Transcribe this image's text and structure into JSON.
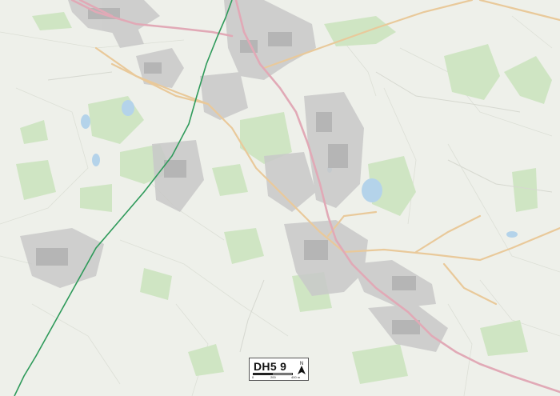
{
  "map": {
    "title": "DH5 9",
    "north_label": "N",
    "scale": {
      "ticks": [
        "0",
        "200",
        "400 m"
      ]
    },
    "colors": {
      "background": "#eef0ea",
      "woodland": "#cfe5c3",
      "water": "#b4d3ea",
      "urban": "#c9c9c9",
      "main_road": "#e1a9b6",
      "secondary_road": "#e9c99a",
      "railway": "#2e9a5a"
    }
  }
}
